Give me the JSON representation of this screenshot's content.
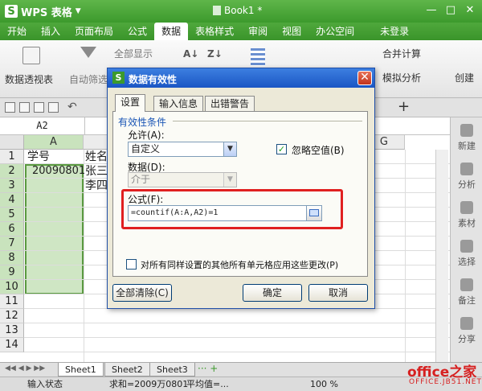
{
  "app": {
    "name": "WPS 表格",
    "document": "Book1 *"
  },
  "menu": [
    "开始",
    "插入",
    "页面布局",
    "公式",
    "数据",
    "表格样式",
    "审阅",
    "视图",
    "办公空间",
    "未登录"
  ],
  "menu_active_index": 4,
  "ribbon": {
    "pivot": "数据透视表",
    "autofilter": "自动筛选",
    "show_all": "全部显示",
    "merge_calc": "合并计算",
    "simulate": "模拟分析",
    "create": "创建"
  },
  "formula_bar": {
    "name_box": "A2"
  },
  "sheet": {
    "columns": [
      "A",
      "G"
    ],
    "rows": [
      "1",
      "2",
      "3",
      "4",
      "5",
      "6",
      "7",
      "8",
      "9",
      "10",
      "11",
      "12",
      "13",
      "14"
    ],
    "cells": {
      "A1": "学号",
      "B1": "姓名",
      "A2": "20090801",
      "B2": "张三",
      "B3": "李四"
    }
  },
  "side_panel": [
    "新建",
    "分析",
    "素材",
    "选择",
    "备注",
    "分享"
  ],
  "sheet_tabs": [
    "Sheet1",
    "Sheet2",
    "Sheet3"
  ],
  "status": {
    "mode": "输入状态",
    "sum": "求和=2009万0801",
    "avg": "平均值=...",
    "zoom": "100 %"
  },
  "watermark": {
    "main": "office之家",
    "sub": "OFFICE.JB51.NET"
  },
  "dialog": {
    "title": "数据有效性",
    "tabs": [
      "设置",
      "输入信息",
      "出错警告"
    ],
    "group_label": "有效性条件",
    "allow_label": "允许(A):",
    "allow_value": "自定义",
    "ignore_blank": "忽略空值(B)",
    "data_label": "数据(D):",
    "data_value": "介于",
    "formula_label": "公式(F):",
    "formula_value": "=countif(A:A,A2)=1",
    "apply_all": "对所有同样设置的其他所有单元格应用这些更改(P)",
    "clear_all": "全部清除(C)",
    "ok": "确定",
    "cancel": "取消"
  },
  "colors": {
    "title_green": "#3c9a2c",
    "dialog_blue": "#1a56c4",
    "highlight_red": "#e02020",
    "selection_green": "#cfe6c4"
  }
}
